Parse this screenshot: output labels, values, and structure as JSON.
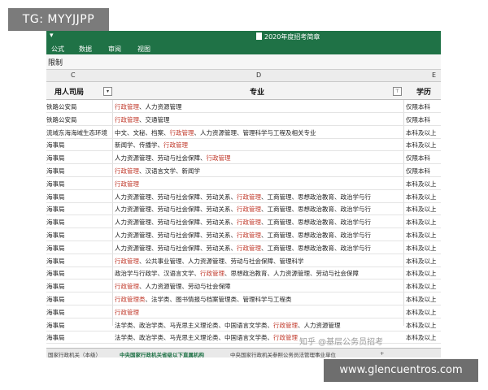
{
  "badges": {
    "tg": "TG: MYYJJPP",
    "site": "www.glencuentros.com"
  },
  "watermark": "知乎 @基层公务员招考",
  "window": {
    "title": "2020年度招考简章",
    "quick_access": "▾",
    "menu": [
      "公式",
      "数据",
      "审阅",
      "视图"
    ]
  },
  "name_bar": "限制",
  "column_letters": [
    "C",
    "D",
    "E"
  ],
  "table": {
    "headers": {
      "c1": "用人司局",
      "c2": "专业",
      "c3": "学历"
    },
    "rows": [
      {
        "a": "铁路公安局",
        "d_hl": "行政管理",
        "d_rest": "、人力资源管理",
        "e": "仅限本科"
      },
      {
        "a": "铁路公安局",
        "d_hl": "行政管理",
        "d_rest": "、交通管理",
        "e": "仅限本科"
      },
      {
        "a": "流域东海海域生态环境",
        "d_pre": "中文、文秘、档案、",
        "d_hl": "行政管理",
        "d_rest": "、人力资源管理、管理科学与工程及相关专业",
        "e": "本科及以上"
      },
      {
        "a": "海事局",
        "d_pre": "新闻学、传播学、",
        "d_hl": "行政管理",
        "d_rest": "",
        "e": "本科及以上"
      },
      {
        "a": "海事局",
        "d_pre": "人力资源管理、劳动与社会保障、",
        "d_hl": "行政管理",
        "d_rest": "",
        "e": "仅限本科"
      },
      {
        "a": "海事局",
        "d_hl": "行政管理",
        "d_rest": "、汉语言文学、新闻学",
        "e": "仅限本科"
      },
      {
        "a": "海事局",
        "d_hl": "行政管理",
        "d_rest": "",
        "e": "本科及以上"
      },
      {
        "a": "海事局",
        "d_pre": "人力资源管理、劳动与社会保障、劳动关系、",
        "d_hl": "行政管理",
        "d_rest": "、工商管理、思想政治教育、政治学与行",
        "e": "本科及以上"
      },
      {
        "a": "海事局",
        "d_pre": "人力资源管理、劳动与社会保障、劳动关系、",
        "d_hl": "行政管理",
        "d_rest": "、工商管理、思想政治教育、政治学与行",
        "e": "本科及以上"
      },
      {
        "a": "海事局",
        "d_pre": "人力资源管理、劳动与社会保障、劳动关系、",
        "d_hl": "行政管理",
        "d_rest": "、工商管理、思想政治教育、政治学与行",
        "e": "本科及以上"
      },
      {
        "a": "海事局",
        "d_pre": "人力资源管理、劳动与社会保障、劳动关系、",
        "d_hl": "行政管理",
        "d_rest": "、工商管理、思想政治教育、政治学与行",
        "e": "本科及以上"
      },
      {
        "a": "海事局",
        "d_pre": "人力资源管理、劳动与社会保障、劳动关系、",
        "d_hl": "行政管理",
        "d_rest": "、工商管理、思想政治教育、政治学与行",
        "e": "本科及以上"
      },
      {
        "a": "海事局",
        "d_hl": "行政管理",
        "d_rest": "、公共事业管理、人力资源管理、劳动与社会保障、管理科学",
        "e": "本科及以上"
      },
      {
        "a": "海事局",
        "d_pre": "政治学与行政学、汉语言文学、",
        "d_hl": "行政管理",
        "d_rest": "、思想政治教育、人力资源管理、劳动与社会保障",
        "e": "本科及以上"
      },
      {
        "a": "海事局",
        "d_hl": "行政管理",
        "d_rest": "、人力资源管理、劳动与社会保障",
        "e": "本科及以上"
      },
      {
        "a": "海事局",
        "d_hl": "行政管理类",
        "d_rest": "、法学类、图书情报与档案管理类、管理科学与工程类",
        "e": "本科及以上"
      },
      {
        "a": "海事局",
        "d_hl": "行政管理",
        "d_rest": "",
        "e": "本科及以上"
      },
      {
        "a": "海事局",
        "d_pre": "法学类、政治学类、马克思主义理论类、中国语言文学类、",
        "d_hl": "行政管理",
        "d_rest": "、人力资源管理",
        "e": "本科及以上"
      },
      {
        "a": "海事局",
        "d_pre": "法学类、政治学类、马克思主义理论类、中国语言文学类、",
        "d_hl": "行政管理",
        "d_rest": "",
        "e": "本科及以上"
      }
    ]
  },
  "sheet_tabs": [
    "国家行政机关（本级）",
    "中央国家行政机关省级以下直属机构",
    "中央国家行政机关参照公务员法管理事业单位",
    "+"
  ]
}
